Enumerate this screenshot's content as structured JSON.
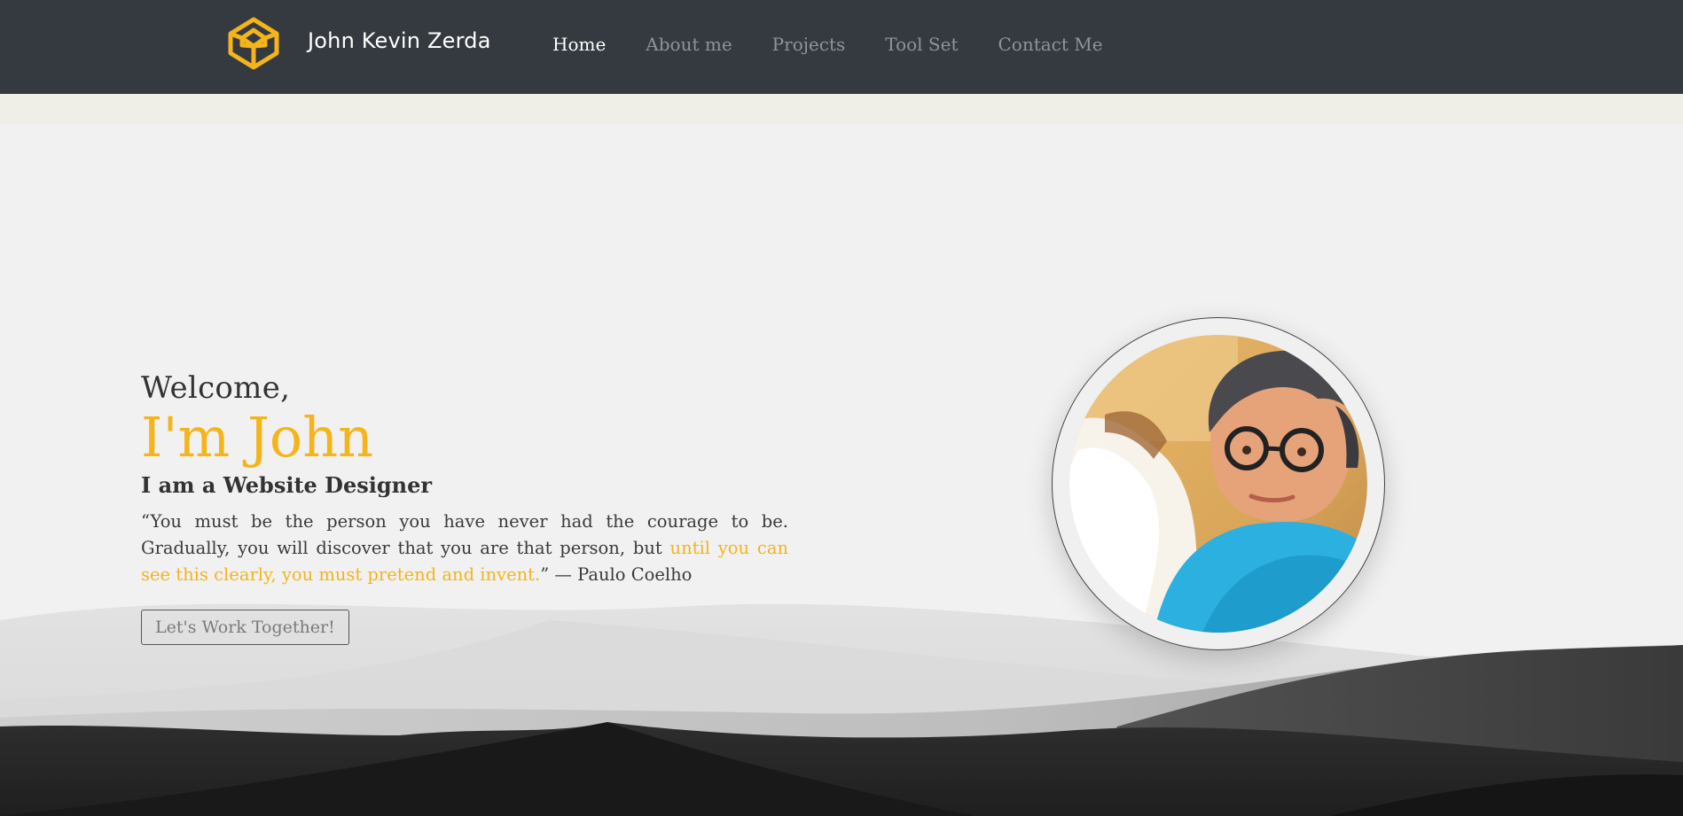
{
  "header": {
    "brand_name": "John Kevin Zerda",
    "logo_icon": "codepen-cube-icon",
    "accent_color": "#f4b41a",
    "nav": [
      {
        "label": "Home",
        "active": true
      },
      {
        "label": "About me",
        "active": false
      },
      {
        "label": "Projects",
        "active": false
      },
      {
        "label": "Tool Set",
        "active": false
      },
      {
        "label": "Contact Me",
        "active": false
      }
    ]
  },
  "hero": {
    "welcome": "Welcome,",
    "name_line": "I'm John",
    "role": "I am a Website Designer",
    "quote_start": "“You must be the person you have never had the courage to be. Gradually, you will discover that you are that person, but ",
    "quote_highlight": "until you can see this clearly, you must pretend and invent.",
    "quote_end": "” — Paulo Coelho",
    "cta_label": "Let's Work Together!",
    "avatar_icon": "profile-photo"
  },
  "colors": {
    "navbar": "#343a40",
    "accent": "#f4b41a",
    "background": "#f1f1f1"
  }
}
